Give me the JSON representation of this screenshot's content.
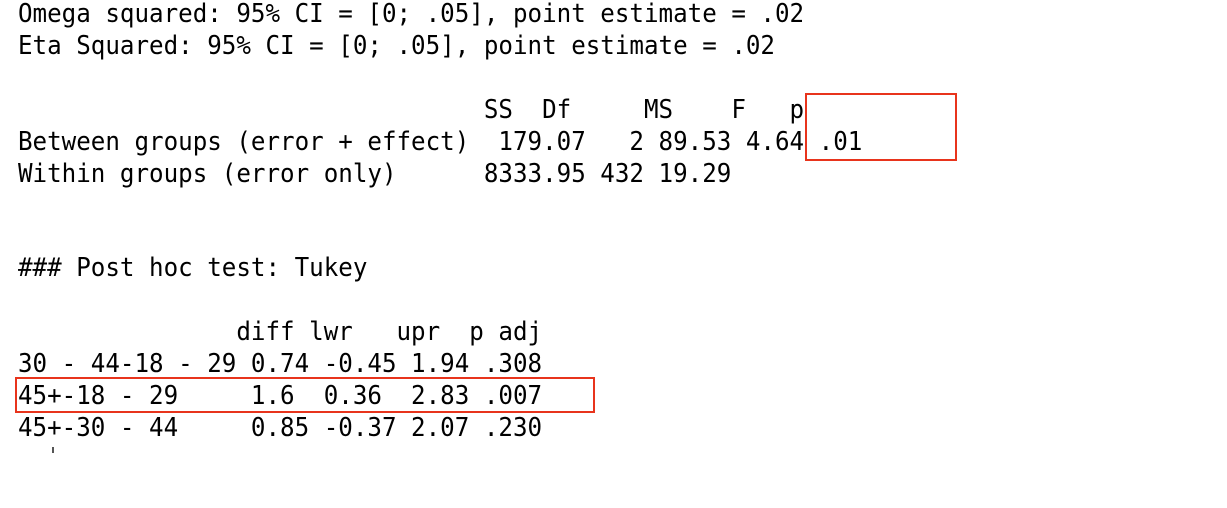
{
  "effect_size": {
    "omega_line": "Omega squared: 95% CI = [0; .05], point estimate = .02",
    "eta_line": "Eta Squared: 95% CI = [0; .05], point estimate = .02"
  },
  "anova_table": {
    "header_line": "                                SS  Df     MS    F   p",
    "row_between": "Between groups (error + effect)  179.07   2 89.53 4.64 .01",
    "row_within": "Within groups (error only)      8333.95 432 19.29"
  },
  "posthoc": {
    "title_line": "### Post hoc test: Tukey",
    "header_line": "               diff lwr   upr  p adj",
    "row_1": "30 - 44-18 - 29 0.74 -0.45 1.94 .308",
    "row_2": "45+-18 - 29     1.6  0.36  2.83 .007",
    "row_3": "45+-30 - 44     0.85 -0.37 2.07 .230"
  },
  "highlight_color": "#e8341c"
}
